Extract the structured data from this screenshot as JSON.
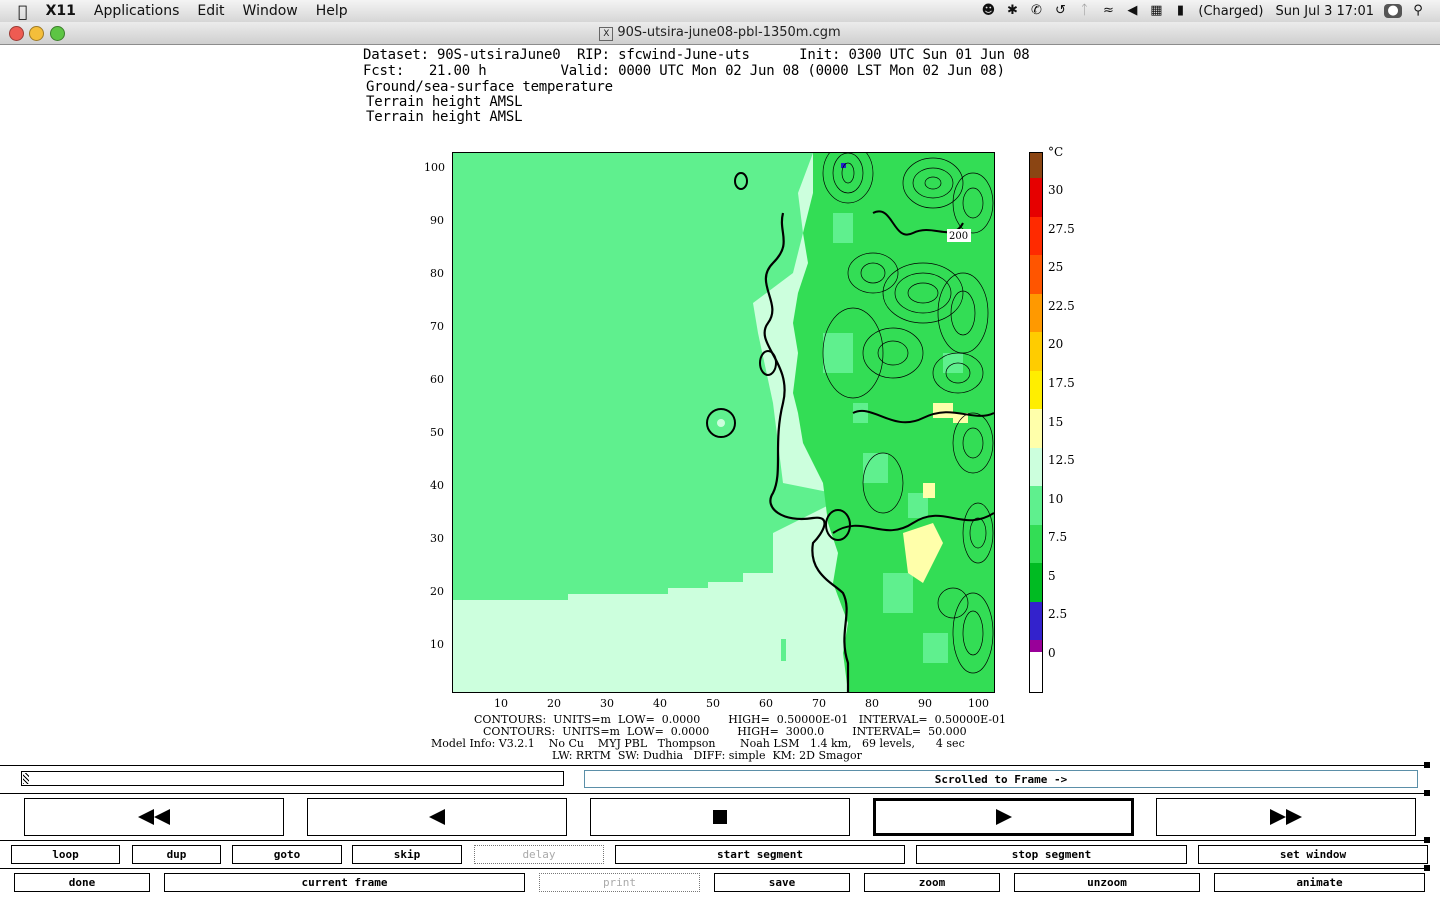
{
  "menubar": {
    "app": "X11",
    "items": [
      "Applications",
      "Edit",
      "Window",
      "Help"
    ],
    "battery": "(Charged)",
    "clock": "Sun Jul 3  17:01"
  },
  "window": {
    "title": "90S-utsira-june08-pbl-1350m.cgm"
  },
  "plot_header": {
    "dataset": "Dataset: 90S-utsiraJune0  RIP: sfcwind-June-uts      Init: 0300 UTC Sun 01 Jun 08",
    "fcst": "Fcst:   21.00 h         Valid: 0000 UTC Mon 02 Jun 08 (0000 LST Mon 02 Jun 08)",
    "field1": "Ground/sea-surface temperature",
    "field2": "Terrain height AMSL",
    "field3": "Terrain height AMSL"
  },
  "axes": {
    "y_ticks": [
      "100",
      "90",
      "80",
      "70",
      "60",
      "50",
      "40",
      "30",
      "20",
      "10"
    ],
    "x_ticks": [
      "10",
      "20",
      "30",
      "40",
      "50",
      "60",
      "70",
      "80",
      "90",
      "100"
    ],
    "contour_label": "200"
  },
  "colorbar": {
    "unit": "°C",
    "labels": [
      "30",
      "27.5",
      "25",
      "22.5",
      "20",
      "17.5",
      "15",
      "12.5",
      "10",
      "7.5",
      "5",
      "2.5",
      "0"
    ],
    "colors": [
      "#8b4513",
      "#e60000",
      "#ff2a00",
      "#ff5500",
      "#ff9900",
      "#ffcc00",
      "#ffee00",
      "#ffffaa",
      "#ccffdd",
      "#5ff08e",
      "#33dd55",
      "#00bb22",
      "#3322cc",
      "#6600aa",
      "#990099"
    ]
  },
  "footer": {
    "line1": "CONTOURS:  UNITS=m  LOW=  0.0000        HIGH=  0.50000E-01   INTERVAL=  0.50000E-01",
    "line2": "CONTOURS:  UNITS=m  LOW=  0.0000        HIGH=  3000.0        INTERVAL=  50.000",
    "line3": "Model Info: V3.2.1    No Cu    MYJ PBL   Thompson       Noah LSM   1.4 km,   69 levels,      4 sec",
    "line4": "LW: RRTM  SW: Dudhia   DIFF: simple  KM: 2D Smagor"
  },
  "controls": {
    "status": "Scrolled to Frame ->",
    "row1": [
      "loop",
      "dup",
      "goto",
      "skip",
      "delay",
      "start segment",
      "stop segment",
      "set window"
    ],
    "row2": [
      "done",
      "current frame",
      "print",
      "save",
      "zoom",
      "unzoom",
      "animate"
    ]
  }
}
